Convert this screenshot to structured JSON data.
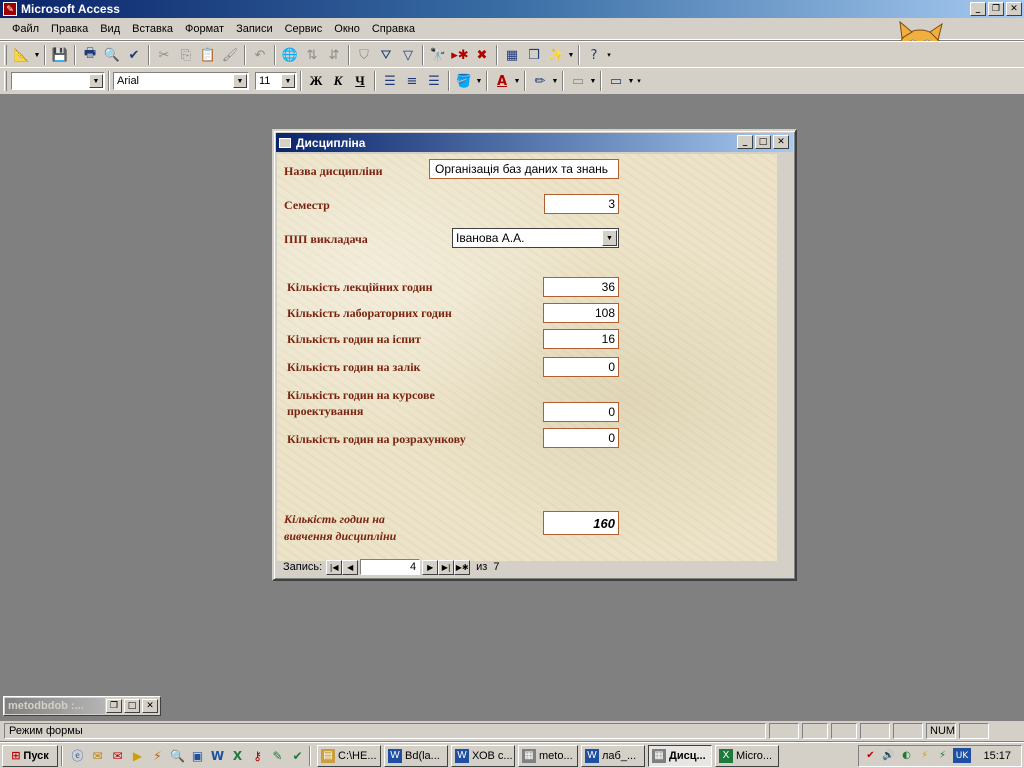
{
  "app": {
    "title": "Microsoft Access"
  },
  "menu": [
    "Файл",
    "Правка",
    "Вид",
    "Вставка",
    "Формат",
    "Записи",
    "Сервис",
    "Окно",
    "Справка"
  ],
  "format_toolbar": {
    "object_combo": "",
    "font_name": "Arial",
    "font_size": "11",
    "bold": "Ж",
    "italic": "К",
    "underline": "Ч"
  },
  "form": {
    "title": "Дисципліна",
    "fields": {
      "name": {
        "label": "Назва дисципліни",
        "value": "Організація баз даних та знань"
      },
      "semester": {
        "label": "Семестр",
        "value": "3"
      },
      "teacher": {
        "label": "ПІП викладача",
        "value": "Іванова А.А."
      },
      "lecture": {
        "label": "Кількість лекційних годин",
        "value": "36"
      },
      "lab": {
        "label": "Кількість лабораторних годин",
        "value": "108"
      },
      "exam": {
        "label": "Кількість годин на іспит",
        "value": "16"
      },
      "credit": {
        "label": "Кількість годин на залік",
        "value": "0"
      },
      "coursework": {
        "label_line1": "Кількість годин на курсове",
        "label_line2": "проектування",
        "value": "0"
      },
      "calc": {
        "label": "Кількість годин на розрахункову",
        "value": "0"
      },
      "total": {
        "label_line1": "Кількість годин на",
        "label_line2": "вивчення дисципліни",
        "value": "160"
      }
    },
    "navigation": {
      "label": "Запись:",
      "current": "4",
      "of_label": "из",
      "total": "7"
    }
  },
  "minimized_window": {
    "title": "metodbdob :..."
  },
  "status": {
    "mode": "Режим формы",
    "num": "NUM"
  },
  "taskbar": {
    "start": "Пуск",
    "tasks": [
      {
        "label": "C:\\НЕ...",
        "icon_color": "#c8a040"
      },
      {
        "label": "Bd(la...",
        "icon_color": "#1f4fa0"
      },
      {
        "label": "ХОВ с...",
        "icon_color": "#1f4fa0"
      },
      {
        "label": "meto...",
        "icon_color": "#808080"
      },
      {
        "label": "лаб_...",
        "icon_color": "#1f4fa0"
      },
      {
        "label": "Дисц...",
        "icon_color": "#808080",
        "active": true
      },
      {
        "label": "Micro...",
        "icon_color": "#1f7a3a"
      }
    ],
    "lang": "UK",
    "clock": "15:17"
  }
}
